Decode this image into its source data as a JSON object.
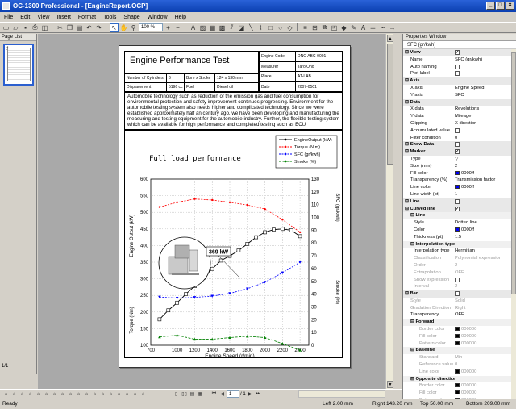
{
  "window": {
    "title": "OC-1300 Professional - [EngineReport.OCP]",
    "buttons": [
      "_",
      "□",
      "×"
    ]
  },
  "menu": [
    "File",
    "Edit",
    "View",
    "Insert",
    "Format",
    "Tools",
    "Shape",
    "Window",
    "Help"
  ],
  "toolbar": {
    "zoom": "100 %"
  },
  "pagelist": {
    "title": "Page List",
    "thumb_number": "1",
    "page_count": "1/1"
  },
  "document": {
    "title": "Engine Performance Test",
    "info": [
      {
        "label": "Engine Code",
        "value": "DNO ABC-0001"
      },
      {
        "label": "Measurer",
        "value": "Taro Ono"
      },
      {
        "label": "Place",
        "value": "AT-LAB"
      },
      {
        "label": "Date",
        "value": "2007-0501"
      }
    ],
    "spec_row1": [
      "Number of Cylinders",
      "6",
      "Bore x Stroke",
      "124 x 130 mm"
    ],
    "spec_row2": [
      "Displacement",
      "5196 cc",
      "Fuel",
      "Diesel oil"
    ],
    "description": "Automobile technology such as reduction of the emission gas and fuel consumption for environmental protection and safety improvement continues progressing.  Environment for the automobile testing system also needs higher and complicated technology.  Since we were established approximately half an century ago, we have been developing and manufacturing the measuring and testing equipment for the automobile industry.  Further, the flexible testing system which can be available for  high performance and completed testing such as ECU"
  },
  "chart_data": {
    "type": "line",
    "title": "Full load performance",
    "xlabel": "Engine Speed (r/min)",
    "ylabel_left_top": "Engine Output (kW)",
    "ylabel_left_bottom": "Torque (Nm)",
    "ylabel_right_top": "SFC (gr/kwh)",
    "ylabel_right_bottom": "Smoke (%)",
    "xlim": [
      700,
      2500
    ],
    "x_ticks": [
      "700",
      "1000",
      "1200",
      "1400",
      "1600",
      "1800",
      "2000",
      "2200",
      "2400"
    ],
    "y_left_ticks": [
      "600",
      "550",
      "500",
      "450",
      "400",
      "350",
      "300",
      "250",
      "200",
      "150",
      "100"
    ],
    "y_right_ticks": [
      "130",
      "120",
      "110",
      "100",
      "90",
      "80",
      "70",
      "60",
      "50",
      "40",
      "30",
      "20",
      "10",
      "0"
    ],
    "annotation": "369 kW",
    "legend": [
      "EngineOutput (kW)",
      "Torque (N m)",
      "SFC (gr/kwh)",
      "Smoke (%)"
    ],
    "colors": {
      "output": "#000000",
      "torque": "#ff0000",
      "sfc": "#0000ff",
      "smoke": "#008000"
    },
    "series": [
      {
        "name": "EngineOutput (kW)",
        "x": [
          800,
          900,
          1000,
          1100,
          1200,
          1300,
          1400,
          1500,
          1600,
          1700,
          1800,
          1900,
          2000,
          2100,
          2200,
          2300,
          2400
        ],
        "values": [
          178,
          205,
          228,
          254,
          278,
          303,
          330,
          355,
          369,
          385,
          405,
          425,
          440,
          448,
          450,
          446,
          428
        ]
      },
      {
        "name": "Torque (N m)",
        "x": [
          800,
          1000,
          1200,
          1400,
          1600,
          1800,
          2000,
          2200,
          2400
        ],
        "values": [
          516,
          530,
          540,
          537,
          530,
          522,
          510,
          478,
          440
        ]
      },
      {
        "name": "SFC (gr/kwh)",
        "x": [
          800,
          1000,
          1200,
          1400,
          1600,
          1800,
          2000,
          2200,
          2400
        ],
        "values": [
          245,
          242,
          244,
          248,
          256,
          270,
          290,
          318,
          350
        ]
      },
      {
        "name": "Smoke (%)",
        "x": [
          800,
          1000,
          1200,
          1400,
          1600,
          1800,
          2000,
          2200,
          2400
        ],
        "values": [
          125,
          130,
          118,
          118,
          123,
          127,
          123,
          105,
          85
        ]
      }
    ]
  },
  "properties": {
    "title": "Properties Window",
    "selected": "SFC (gr/kwh)",
    "rows": [
      {
        "k": "View",
        "v": "",
        "type": "cat",
        "check": "✓"
      },
      {
        "k": "Name",
        "v": "SFC (gr/kwh)"
      },
      {
        "k": "Auto naming",
        "v": "",
        "check": ""
      },
      {
        "k": "Plot label",
        "v": "",
        "check": ""
      },
      {
        "k": "Axis",
        "v": "",
        "type": "cat"
      },
      {
        "k": "X axis",
        "v": "Engine Speed"
      },
      {
        "k": "Y axis",
        "v": "SFC"
      },
      {
        "k": "Data",
        "v": "",
        "type": "cat"
      },
      {
        "k": "X data",
        "v": "Revolutions"
      },
      {
        "k": "Y data",
        "v": "Mileage"
      },
      {
        "k": "Clipping",
        "v": "X direction"
      },
      {
        "k": "Accumulated value",
        "v": "",
        "check": ""
      },
      {
        "k": "Filter condition",
        "v": "0"
      },
      {
        "k": "Show Data",
        "v": "",
        "type": "cat",
        "check": ""
      },
      {
        "k": "Marker",
        "v": "",
        "type": "cat",
        "check": "✓"
      },
      {
        "k": "Type",
        "v": "▽"
      },
      {
        "k": "Size (mm)",
        "v": "2"
      },
      {
        "k": "Fill color",
        "v": "0000ff",
        "swatch": "#0000ff"
      },
      {
        "k": "Transparency (%)",
        "v": "Transmission factor"
      },
      {
        "k": "Line color",
        "v": "0000ff",
        "swatch": "#0000ff"
      },
      {
        "k": "Line width (pt)",
        "v": "1"
      },
      {
        "k": "Line",
        "v": "",
        "type": "cat",
        "check": ""
      },
      {
        "k": "Curved line",
        "v": "",
        "type": "cat",
        "check": "✓"
      },
      {
        "k": "Line",
        "v": "",
        "type": "subcat"
      },
      {
        "k": "Style",
        "v": "Dotted line",
        "type": "sub"
      },
      {
        "k": "Color",
        "v": "0000ff",
        "type": "sub",
        "swatch": "#0000ff"
      },
      {
        "k": "Thickness (pt)",
        "v": "1.5",
        "type": "sub"
      },
      {
        "k": "Interpolation type",
        "v": "",
        "type": "subcat"
      },
      {
        "k": "Interpolation type",
        "v": "Hermitian",
        "type": "sub"
      },
      {
        "k": "Classification",
        "v": "Polynomial expression",
        "type": "sub dis"
      },
      {
        "k": "Order",
        "v": "2",
        "type": "sub dis"
      },
      {
        "k": "Extrapolation",
        "v": "OFF",
        "type": "sub dis"
      },
      {
        "k": "Show expression",
        "v": "",
        "type": "sub dis",
        "check": ""
      },
      {
        "k": "Interval",
        "v": "2",
        "type": "sub dis"
      },
      {
        "k": "Bar",
        "v": "",
        "type": "cat",
        "check": ""
      },
      {
        "k": "Style",
        "v": "Solid",
        "type": "dis"
      },
      {
        "k": "Gradation Direction",
        "v": "Right",
        "type": "dis"
      },
      {
        "k": "Transparency",
        "v": "OFF"
      },
      {
        "k": "Forward",
        "v": "",
        "type": "subcat"
      },
      {
        "k": "Border color",
        "v": "000000",
        "type": "sub2 dis",
        "swatch": "#000000"
      },
      {
        "k": "Fill color",
        "v": "000000",
        "type": "sub2 dis",
        "swatch": "#000000"
      },
      {
        "k": "Pattern color",
        "v": "000000",
        "type": "sub2 dis",
        "swatch": "#000000"
      },
      {
        "k": "Baseline",
        "v": "",
        "type": "subcat"
      },
      {
        "k": "Standard",
        "v": "Min",
        "type": "sub2 dis"
      },
      {
        "k": "Reference value",
        "v": "0",
        "type": "sub2 dis"
      },
      {
        "k": "Line color",
        "v": "000000",
        "type": "sub2 dis",
        "swatch": "#000000"
      },
      {
        "k": "Opposite direction",
        "v": "",
        "type": "subcat"
      },
      {
        "k": "Border color",
        "v": "000000",
        "type": "sub2 dis",
        "swatch": "#000000"
      },
      {
        "k": "Fill color",
        "v": "000000",
        "type": "sub2 dis",
        "swatch": "#000000"
      },
      {
        "k": "Pattern color",
        "v": "000000",
        "type": "sub2 dis",
        "swatch": "#000000"
      }
    ]
  },
  "pager": {
    "current": "1",
    "total": "/ 1"
  },
  "status": {
    "ready": "Ready",
    "left": "Left   2.00 mm",
    "right": "Right   143.20 mm",
    "top": "Top   50.00 mm",
    "bottom": "Bottom   209.00 mm"
  }
}
